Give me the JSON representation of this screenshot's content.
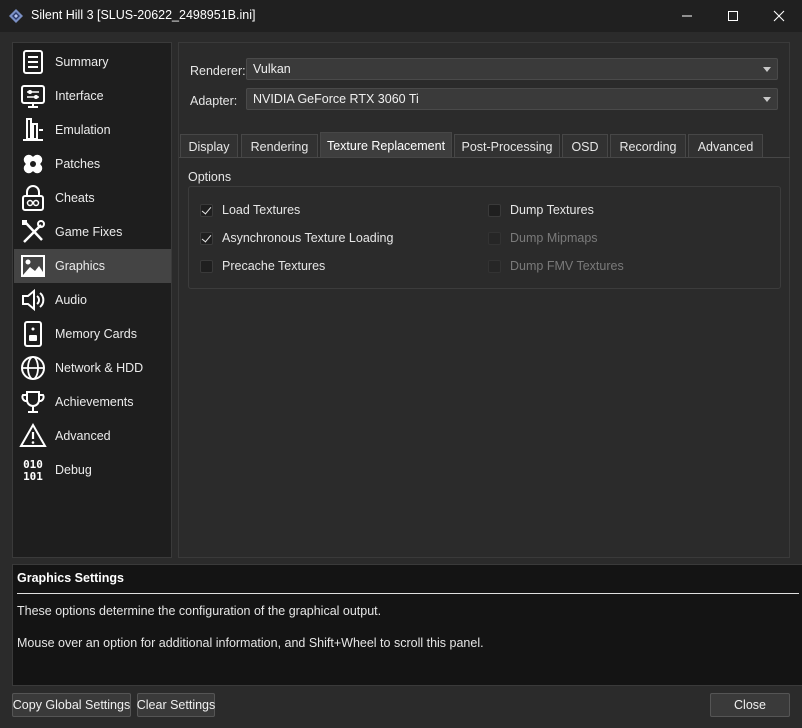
{
  "window": {
    "title": "Silent Hill 3 [SLUS-20622_2498951B.ini]"
  },
  "sidebar": {
    "items": [
      {
        "label": "Summary",
        "icon": "document-list-icon"
      },
      {
        "label": "Interface",
        "icon": "interface-settings-icon"
      },
      {
        "label": "Emulation",
        "icon": "chip-icon"
      },
      {
        "label": "Patches",
        "icon": "bandage-icon"
      },
      {
        "label": "Cheats",
        "icon": "lock-icon"
      },
      {
        "label": "Game Fixes",
        "icon": "tools-icon"
      },
      {
        "label": "Graphics",
        "icon": "image-icon"
      },
      {
        "label": "Audio",
        "icon": "speaker-icon"
      },
      {
        "label": "Memory Cards",
        "icon": "memory-card-icon"
      },
      {
        "label": "Network & HDD",
        "icon": "globe-icon"
      },
      {
        "label": "Achievements",
        "icon": "trophy-icon"
      },
      {
        "label": "Advanced",
        "icon": "warning-icon"
      },
      {
        "label": "Debug",
        "icon": "binary-icon"
      }
    ],
    "active": "Graphics"
  },
  "renderer": {
    "label": "Renderer:",
    "value": "Vulkan"
  },
  "adapter": {
    "label": "Adapter:",
    "value": "NVIDIA GeForce RTX 3060 Ti"
  },
  "tabs": [
    {
      "label": "Display"
    },
    {
      "label": "Rendering"
    },
    {
      "label": "Texture Replacement"
    },
    {
      "label": "Post-Processing"
    },
    {
      "label": "OSD"
    },
    {
      "label": "Recording"
    },
    {
      "label": "Advanced"
    }
  ],
  "active_tab": "Texture Replacement",
  "options": {
    "title": "Options",
    "left": [
      {
        "label": "Load Textures",
        "checked": true,
        "enabled": true
      },
      {
        "label": "Asynchronous Texture Loading",
        "checked": true,
        "enabled": true
      },
      {
        "label": "Precache Textures",
        "checked": false,
        "enabled": true
      }
    ],
    "right": [
      {
        "label": "Dump Textures",
        "checked": false,
        "enabled": true
      },
      {
        "label": "Dump Mipmaps",
        "checked": false,
        "enabled": false
      },
      {
        "label": "Dump FMV Textures",
        "checked": false,
        "enabled": false
      }
    ]
  },
  "info": {
    "title": "Graphics Settings",
    "line1": "These options determine the configuration of the graphical output.",
    "line2": "Mouse over an option for additional information, and Shift+Wheel to scroll this panel."
  },
  "buttons": {
    "copy_global": "Copy Global Settings",
    "clear": "Clear Settings",
    "close": "Close"
  },
  "colors": {
    "window_bg": "#2b2b2b",
    "sidebar_bg": "#1e1e1e",
    "active_item": "#444444",
    "info_bg": "#141414"
  }
}
